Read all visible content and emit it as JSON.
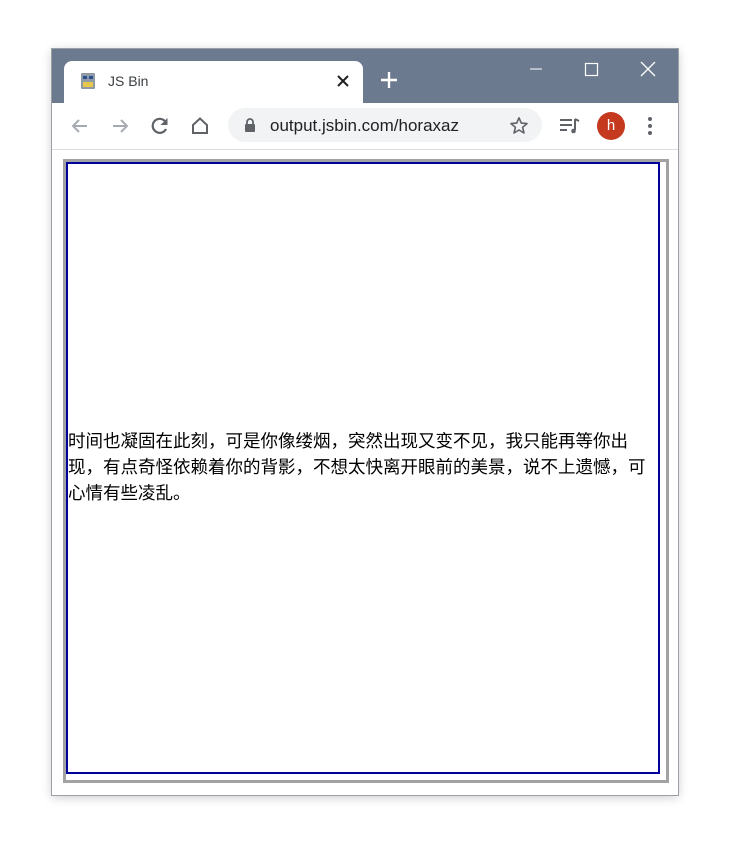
{
  "browser": {
    "tab": {
      "title": "JS Bin",
      "favicon": "jsbin-favicon-icon",
      "close_icon": "close-icon"
    },
    "new_tab_icon": "plus-icon",
    "window_controls": [
      "minimize-icon",
      "maximize-icon",
      "close-icon"
    ],
    "nav": [
      "back-icon",
      "forward-icon",
      "reload-icon",
      "home-icon"
    ],
    "address": {
      "url": "output.jsbin.com/horaxaz",
      "lock_icon": "lock-icon",
      "bookmark_icon": "star-icon"
    },
    "extras": [
      "media-control-icon",
      "kebab-menu-icon"
    ],
    "profile": {
      "initial": "h",
      "color": "#c5391f"
    }
  },
  "page": {
    "text": "时间也凝固在此刻，可是你像缕烟，突然出现又变不见，我只能再等你出现，有点奇怪依赖着你的背影，不想太快离开眼前的美景，说不上遗憾，可心情有些凌乱。",
    "colors": {
      "outer_border": "#a2a2a2",
      "inner_border": "#00009e"
    }
  },
  "colors": {
    "tabstrip": "#6b7a8f",
    "omnibox": "#f1f3f4"
  }
}
